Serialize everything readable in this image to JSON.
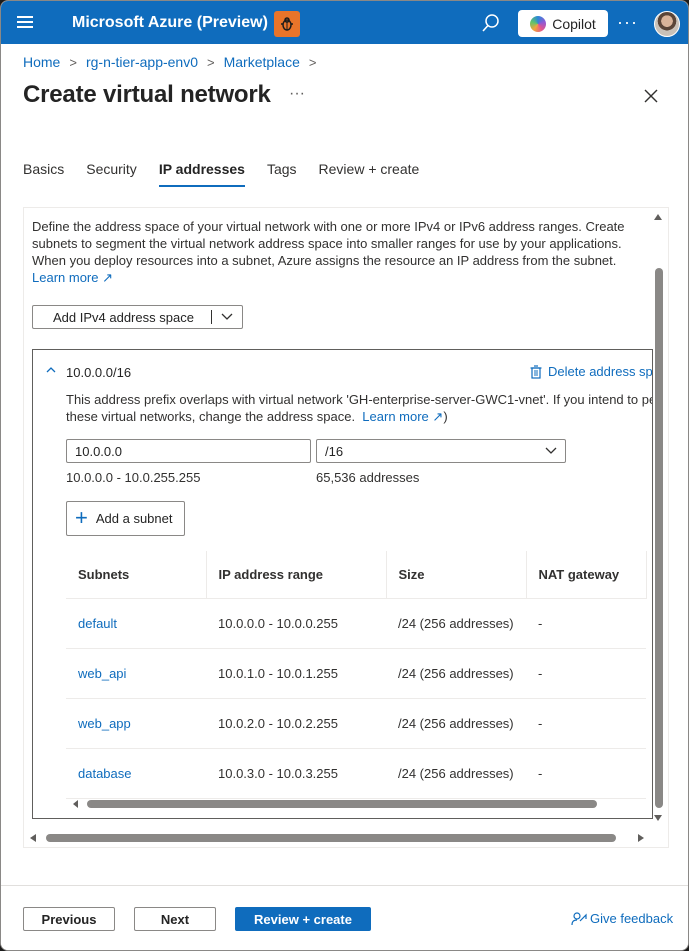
{
  "header": {
    "brand": "Microsoft Azure (Preview)",
    "copilot_label": "Copilot",
    "more_label": "···"
  },
  "breadcrumb": [
    "Home",
    "rg-n-tier-app-env0",
    "Marketplace"
  ],
  "page": {
    "title": "Create virtual network",
    "title_more": "···"
  },
  "tabs": [
    {
      "label": "Basics",
      "active": false
    },
    {
      "label": "Security",
      "active": false
    },
    {
      "label": "IP addresses",
      "active": true
    },
    {
      "label": "Tags",
      "active": false
    },
    {
      "label": "Review + create",
      "active": false
    }
  ],
  "description": {
    "text": "Define the address space of your virtual network with one or more IPv4 or IPv6 address ranges. Create subnets to segment the virtual network address space into smaller ranges for use by your applications. When you deploy resources into a subnet, Azure assigns the resource an IP address from the subnet.",
    "learn_more": "Learn more"
  },
  "add_space_button": "Add IPv4 address space",
  "address_space": {
    "title": "10.0.0.0/16",
    "delete_label": "Delete address space",
    "warning_line1": "This address prefix overlaps with virtual network 'GH-enterprise-server-GWC1-vnet'. If you intend to peer",
    "warning_line2": "these virtual networks, change the address space.",
    "warning_learn_more": "Learn more",
    "ip_value": "10.0.0.0",
    "prefix_value": "/16",
    "range": "10.0.0.0 - 10.0.255.255",
    "address_count": "65,536 addresses",
    "add_subnet_label": "Add a subnet"
  },
  "subnets_table": {
    "columns": [
      "Subnets",
      "IP address range",
      "Size",
      "NAT gateway"
    ],
    "rows": [
      {
        "name": "default",
        "range": "10.0.0.0 - 10.0.0.255",
        "size": "/24 (256 addresses)",
        "nat": "-"
      },
      {
        "name": "web_api",
        "range": "10.0.1.0 - 10.0.1.255",
        "size": "/24 (256 addresses)",
        "nat": "-"
      },
      {
        "name": "web_app",
        "range": "10.0.2.0 - 10.0.2.255",
        "size": "/24 (256 addresses)",
        "nat": "-"
      },
      {
        "name": "database",
        "range": "10.0.3.0 - 10.0.3.255",
        "size": "/24 (256 addresses)",
        "nat": "-"
      }
    ]
  },
  "footer": {
    "previous": "Previous",
    "next": "Next",
    "review_create": "Review + create",
    "feedback": "Give feedback"
  },
  "colors": {
    "accent": "#0f6cbd",
    "badge": "#e8742a"
  }
}
